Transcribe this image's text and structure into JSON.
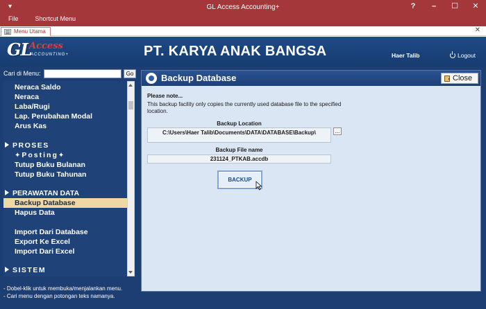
{
  "window": {
    "title": "GL Access Accounting+",
    "menu": [
      "File",
      "Shortcut Menu"
    ],
    "controls": {
      "help": "?",
      "minimize": "–",
      "maximize": "☐",
      "close": "✕"
    }
  },
  "tab": {
    "label": "Menu Utama",
    "close": "✕"
  },
  "header": {
    "logo": {
      "main": "GL",
      "accent": "Access",
      "sub": "ACCOUNTING+"
    },
    "company": "PT. KARYA ANAK BANGSA",
    "user": "Haer Talib",
    "logout": "Logout"
  },
  "sidebar": {
    "search_label": "Cari di Menu:",
    "search_value": "",
    "go_label": "Go",
    "items": [
      "Neraca Saldo",
      "Neraca",
      "Laba/Rugi",
      "Lap. Perubahan Modal",
      "Arus Kas",
      "PROSES",
      "Posting",
      "Tutup Buku Bulanan",
      "Tutup Buku Tahunan",
      "PERAWATAN DATA",
      "Backup Database",
      "Hapus Data",
      "Import Dari Database",
      "Export Ke Excel",
      "Import Dari Excel",
      "SISTEM"
    ],
    "hints": [
      "- Dobel-klik untuk membuka/menjalankan menu.",
      "- Cari menu dengan potongan teks namanya."
    ]
  },
  "panel": {
    "title": "Backup Database",
    "close_label": "Close",
    "note_title": "Please note...",
    "note_body": "This backup facility only copies the currently used database file to the specified location.",
    "location_label": "Backup Location",
    "location_value": "C:\\Users\\Haer Talib\\Documents\\DATA\\DATABASE\\Backup\\",
    "browse_label": "...",
    "file_label": "Backup File name",
    "file_value": "231124_PTKAB.accdb",
    "backup_label": "BACKUP"
  },
  "colors": {
    "titlebar": "#a4373a",
    "navy": "#1d3e72",
    "selected": "#efd7a6",
    "panel": "#dbe6f4"
  }
}
